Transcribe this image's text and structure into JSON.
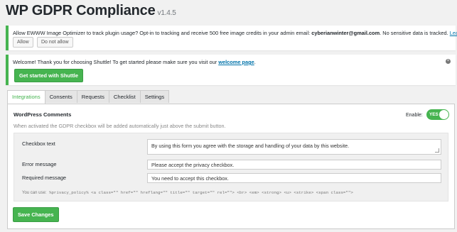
{
  "header": {
    "title": "WP GDPR Compliance",
    "version": "v1.4.5"
  },
  "ewww_notice": {
    "text": "Allow EWWW Image Optimizer to track plugin usage? Opt-in to tracking and receive 500 free image credits in your admin email: ",
    "email": "cyberianwinter@gmail.com",
    "suffix": ". No sensitive data is tracked. ",
    "learn_more": "Learn more.",
    "allow_label": "Allow",
    "deny_label": "Do not allow"
  },
  "shuttle_notice": {
    "text": "Welcome! Thank you for choosing Shuttle! To get started please make sure you visit our ",
    "link": "welcome page",
    "period": ".",
    "button_label": "Get started with Shuttle"
  },
  "tabs": [
    {
      "label": "Integrations",
      "active": true
    },
    {
      "label": "Consents"
    },
    {
      "label": "Requests"
    },
    {
      "label": "Checklist"
    },
    {
      "label": "Settings"
    }
  ],
  "integration": {
    "title": "WordPress Comments",
    "description": "When activated the GDPR checkbox will be added automatically just above the submit button.",
    "enable_label": "Enable:",
    "toggle_label": "YES",
    "fields": [
      {
        "label": "Checkbox text",
        "value": "By using this form you agree with the storage and handling of your data by this website."
      },
      {
        "label": "Error message",
        "value": "Please accept the privacy checkbox."
      },
      {
        "label": "Required message",
        "value": "You need to accept this checkbox."
      }
    ],
    "help_prefix": "You can use:",
    "help_code": "%privacy_policy% <a class=\"\" href=\"\" hreflang=\"\" title=\"\" target=\"\" rel=\"\"> <br> <em> <strong> <u> <strike> <span class=\"\">",
    "save_label": "Save Changes"
  },
  "colors": {
    "accent": "#46b450",
    "link": "#0073aa",
    "background": "#f1f1f1"
  }
}
